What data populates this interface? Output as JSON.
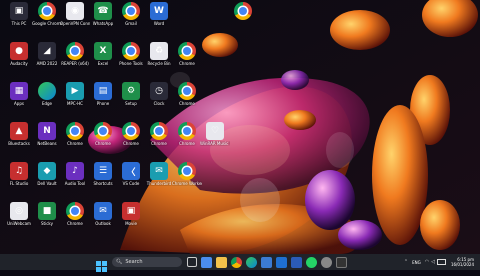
{
  "desktop": {
    "icons": [
      {
        "label": "This PC",
        "kind": "tile-dark",
        "glyph": "▣"
      },
      {
        "label": "Google Chrome",
        "kind": "chrome",
        "glyph": ""
      },
      {
        "label": "OpenVPN Connect",
        "kind": "tile-white",
        "glyph": "◉"
      },
      {
        "label": "WhatsApp",
        "kind": "tile-green",
        "glyph": "☎"
      },
      {
        "label": "Gmail",
        "kind": "chrome",
        "glyph": ""
      },
      {
        "label": "Word",
        "kind": "tile-blue",
        "glyph": "W"
      },
      {
        "label": "",
        "kind": "chrome",
        "glyph": ""
      },
      {
        "label": "Audacity",
        "kind": "tile-red",
        "glyph": "●"
      },
      {
        "label": "AMD 2022",
        "kind": "tile-dark",
        "glyph": "◢"
      },
      {
        "label": "REAPER (x64)",
        "kind": "chrome",
        "glyph": ""
      },
      {
        "label": "Excel",
        "kind": "tile-green",
        "glyph": "X"
      },
      {
        "label": "Phone Tools",
        "kind": "chrome",
        "glyph": ""
      },
      {
        "label": "Recycle Bin",
        "kind": "tile-white",
        "glyph": "♻"
      },
      {
        "label": "Chrome",
        "kind": "chrome",
        "glyph": ""
      },
      {
        "label": "Apps",
        "kind": "tile-purple",
        "glyph": "▦"
      },
      {
        "label": "Edge",
        "kind": "edge",
        "glyph": ""
      },
      {
        "label": "MPC-HC",
        "kind": "tile-teal",
        "glyph": "▶"
      },
      {
        "label": "Phone",
        "kind": "tile-blue",
        "glyph": "▤"
      },
      {
        "label": "Setup",
        "kind": "tile-green",
        "glyph": "⚙"
      },
      {
        "label": "Clock",
        "kind": "tile-dark",
        "glyph": "◷"
      },
      {
        "label": "Chrome",
        "kind": "chrome",
        "glyph": ""
      },
      {
        "label": "Bluestacks",
        "kind": "tile-red",
        "glyph": "▲"
      },
      {
        "label": "NetBeans",
        "kind": "tile-purple",
        "glyph": "N"
      },
      {
        "label": "Chrome",
        "kind": "chrome",
        "glyph": ""
      },
      {
        "label": "Chrome",
        "kind": "chrome",
        "glyph": ""
      },
      {
        "label": "Chrome",
        "kind": "chrome",
        "glyph": ""
      },
      {
        "label": "Chrome",
        "kind": "chrome",
        "glyph": ""
      },
      {
        "label": "Chrome",
        "kind": "chrome",
        "glyph": ""
      },
      {
        "label": "WinRAR Music Maker",
        "kind": "tile-white",
        "glyph": "♡"
      },
      {
        "label": "FL Studio",
        "kind": "tile-red",
        "glyph": "♫"
      },
      {
        "label": "Dell Vault",
        "kind": "tile-teal",
        "glyph": "◆"
      },
      {
        "label": "Audio Tool",
        "kind": "tile-purple",
        "glyph": "♪"
      },
      {
        "label": "Shortcuts",
        "kind": "tile-blue",
        "glyph": "☰"
      },
      {
        "label": "VS Code",
        "kind": "tile-blue",
        "glyph": "〈"
      },
      {
        "label": "Thunderbird",
        "kind": "tile-teal",
        "glyph": "✉"
      },
      {
        "label": "Chrome Worker",
        "kind": "chrome",
        "glyph": ""
      },
      {
        "label": "UniWebcam",
        "kind": "tile-white",
        "glyph": "◎"
      },
      {
        "label": "Sticky",
        "kind": "tile-green",
        "glyph": "■"
      },
      {
        "label": "Chrome",
        "kind": "chrome",
        "glyph": ""
      },
      {
        "label": "Outlook",
        "kind": "tile-blue",
        "glyph": "✉"
      },
      {
        "label": "Movie",
        "kind": "tile-red",
        "glyph": "▣"
      }
    ]
  },
  "taskbar": {
    "search_label": "Search",
    "tray": {
      "lang": "ENG",
      "time": "6:15 pm",
      "date": "16/01/2024"
    }
  }
}
